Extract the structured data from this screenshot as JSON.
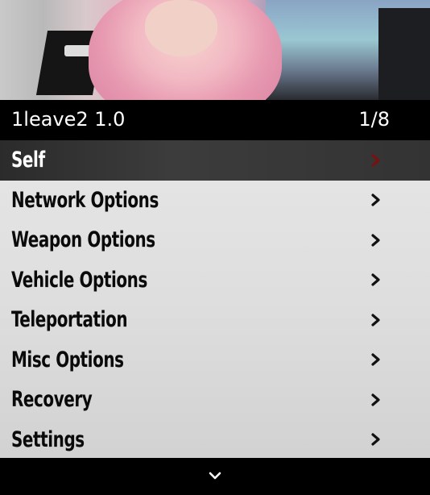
{
  "header": {
    "title": "1leave2 1.0",
    "counter": "1/8"
  },
  "menu": {
    "selected_index": 0,
    "items": [
      {
        "label": "Self",
        "icon": "chevron-right-icon"
      },
      {
        "label": "Network Options",
        "icon": "chevron-right-icon"
      },
      {
        "label": "Weapon Options",
        "icon": "chevron-right-icon"
      },
      {
        "label": "Vehicle Options",
        "icon": "chevron-right-icon"
      },
      {
        "label": "Teleportation",
        "icon": "chevron-right-icon"
      },
      {
        "label": "Misc Options",
        "icon": "chevron-right-icon"
      },
      {
        "label": "Recovery",
        "icon": "chevron-right-icon"
      },
      {
        "label": "Settings",
        "icon": "chevron-right-icon"
      }
    ]
  },
  "footer": {
    "icon": "chevron-down-icon"
  },
  "colors": {
    "title_bg": "#000000",
    "item_bg": "#e2e2e2",
    "selected_bg": "#333333",
    "selected_chevron": "#7a1010",
    "chevron": "#111111"
  }
}
